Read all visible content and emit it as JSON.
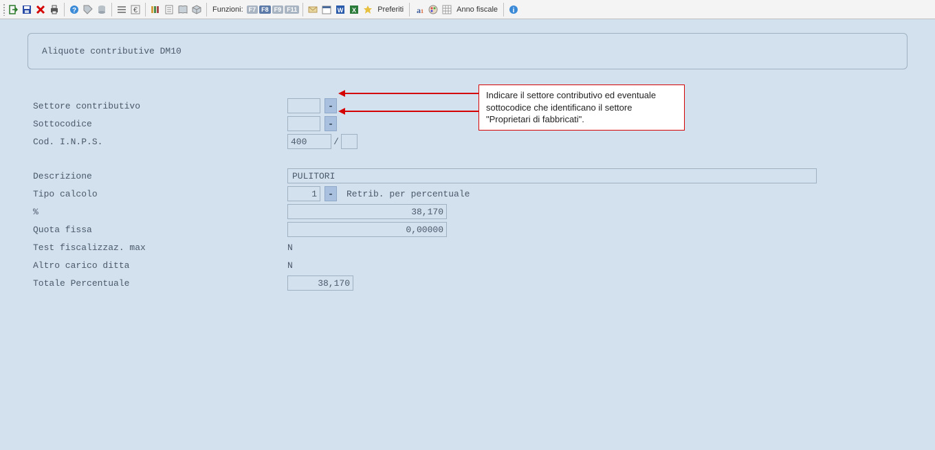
{
  "toolbar": {
    "funzioni_label": "Funzioni:",
    "preferiti_label": "Preferiti",
    "anno_fiscale_label": "Anno fiscale",
    "fkeys": [
      "F7",
      "F8",
      "F9",
      "F11"
    ]
  },
  "panel": {
    "title": "Aliquote contributive DM10"
  },
  "form": {
    "settore_label": "Settore contributivo",
    "settore_value": "",
    "sottocodice_label": "Sottocodice",
    "sottocodice_value": "",
    "cod_inps_label": "Cod. I.N.P.S.",
    "cod_inps_value": "400",
    "cod_inps_suffix": "",
    "descrizione_label": "Descrizione",
    "descrizione_value": "PULITORI",
    "tipo_calcolo_label": "Tipo calcolo",
    "tipo_calcolo_value": "1",
    "tipo_calcolo_desc": "Retrib. per percentuale",
    "percent_label": "%",
    "percent_value": "38,170",
    "quota_fissa_label": "Quota fissa",
    "quota_fissa_value": "0,00000",
    "test_fisc_label": "Test fiscalizzaz. max",
    "test_fisc_value": "N",
    "altro_carico_label": "Altro carico ditta",
    "altro_carico_value": "N",
    "totale_perc_label": "Totale Percentuale",
    "totale_perc_value": "38,170"
  },
  "callout": {
    "text": "Indicare il settore contributivo ed eventuale sottocodice che identificano il settore \"Proprietari di fabbricati\"."
  }
}
